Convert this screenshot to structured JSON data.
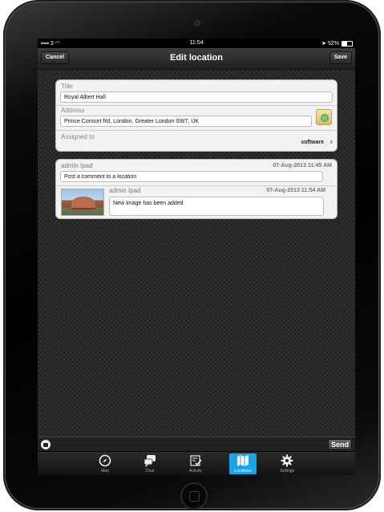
{
  "status_bar": {
    "carrier": "3",
    "time": "11:54",
    "battery": "52%"
  },
  "nav": {
    "title": "Edit location",
    "cancel": "Cancel",
    "save": "Save"
  },
  "form": {
    "title_label": "Title",
    "title_value": "Royal Albert Hall",
    "address_label": "Address",
    "address_value": "Prince Consort Rd, London, Greater London SW7, UK",
    "assigned_label": "Assigned to",
    "assigned_value": "software"
  },
  "comments": {
    "new_comment": {
      "author": "admin Ipad",
      "timestamp": "07-Aug-2013 11:45 AM",
      "placeholder": "Post a comment to a location"
    },
    "items": [
      {
        "author": "admin Ipad",
        "timestamp": "07-Aug-2013 11:54 AM",
        "text": "New Image has been added"
      }
    ]
  },
  "input_bar": {
    "send": "Send"
  },
  "tabs": [
    {
      "label": "Map",
      "icon": "compass-icon",
      "active": false
    },
    {
      "label": "Chat",
      "icon": "chat-bubbles-icon",
      "active": false
    },
    {
      "label": "Activity",
      "icon": "activity-checklist-icon",
      "active": false
    },
    {
      "label": "Locations",
      "icon": "map-folded-icon",
      "active": true
    },
    {
      "label": "Settings",
      "icon": "gear-icon",
      "active": false
    }
  ],
  "colors": {
    "accent": "#1aa3e8",
    "chevron": "#1f8fe6"
  }
}
